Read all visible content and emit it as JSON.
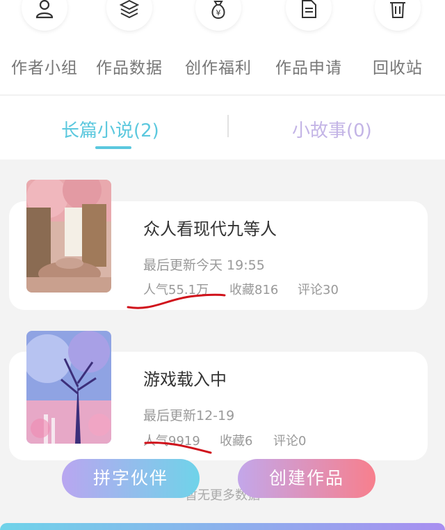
{
  "menu": {
    "items": [
      {
        "label": "作者小组",
        "icon": "person-icon"
      },
      {
        "label": "作品数据",
        "icon": "layers-icon"
      },
      {
        "label": "创作福利",
        "icon": "money-bag-icon"
      },
      {
        "label": "作品申请",
        "icon": "document-icon"
      },
      {
        "label": "回收站",
        "icon": "trash-icon"
      }
    ]
  },
  "tabs": {
    "active": "长篇小说(2)",
    "inactive": "小故事(0)"
  },
  "works": [
    {
      "title": "众人看现代九等人",
      "updated": "最后更新今天 19:55",
      "popularity": "人气55.1万",
      "favorites": "收藏816",
      "comments": "评论30"
    },
    {
      "title": "游戏载入中",
      "updated": "最后更新12-19",
      "popularity": "人气9919",
      "favorites": "收藏6",
      "comments": "评论0"
    }
  ],
  "buttons": {
    "partner": "拼字伙伴",
    "create": "创建作品"
  },
  "footer": {
    "no_more": "暂无更多数据"
  },
  "colors": {
    "accent": "#5bc8de",
    "inactive_tab": "#c3b4e6",
    "annotation_red": "#d0121b"
  }
}
